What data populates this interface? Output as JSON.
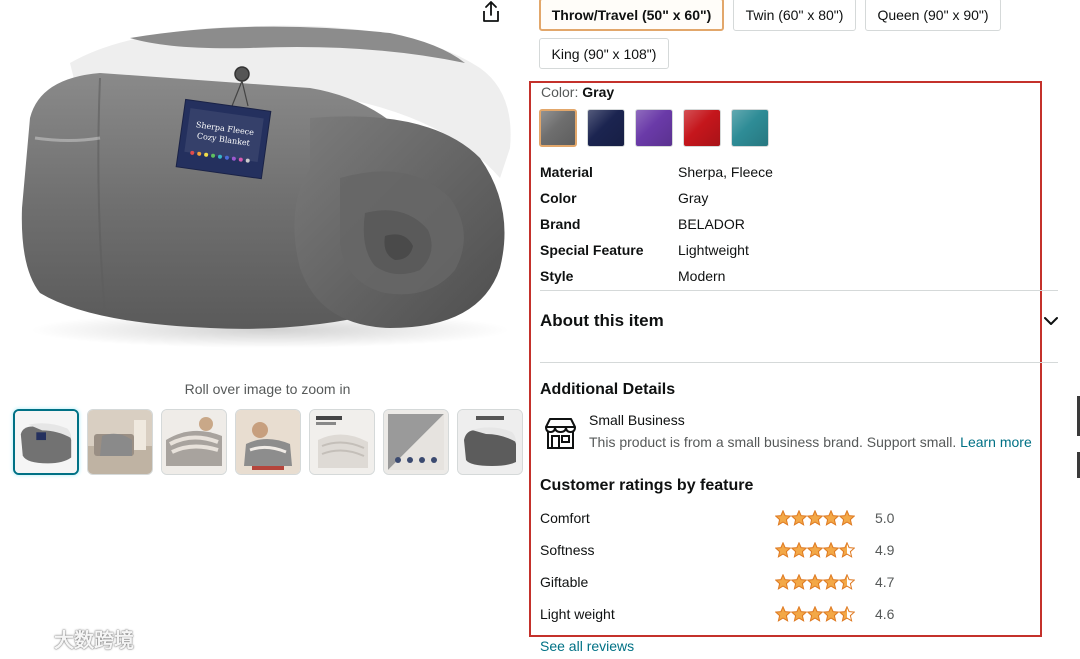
{
  "product": {
    "zoom_hint": "Roll over image to zoom in",
    "tag_line1": "Sherpa Fleece",
    "tag_line2": "Cozy Blanket",
    "tag_brand": "BELADOR"
  },
  "sizes": [
    {
      "label": "Throw/Travel (50\" x 60\")",
      "selected": true
    },
    {
      "label": "Twin (60\" x 80\")",
      "selected": false
    },
    {
      "label": "Queen (90\" x 90\")",
      "selected": false
    },
    {
      "label": "King (90\" x 108\")",
      "selected": false
    }
  ],
  "color": {
    "label": "Color:",
    "selected": "Gray",
    "swatches": [
      "#6e6e6e",
      "#1b2450",
      "#6a3aa8",
      "#c5161c",
      "#2e8c96"
    ]
  },
  "specs": [
    {
      "key": "Material",
      "value": "Sherpa, Fleece"
    },
    {
      "key": "Color",
      "value": "Gray"
    },
    {
      "key": "Brand",
      "value": "BELADOR"
    },
    {
      "key": "Special Feature",
      "value": "Lightweight"
    },
    {
      "key": "Style",
      "value": "Modern"
    }
  ],
  "about": {
    "title": "About this item"
  },
  "additional": {
    "title": "Additional Details",
    "sb_title": "Small Business",
    "sb_desc": "This product is from a small business brand. Support small.",
    "learn_more": "Learn more"
  },
  "ratings": {
    "title": "Customer ratings by feature",
    "items": [
      {
        "name": "Comfort",
        "value": "5.0",
        "stars": 5
      },
      {
        "name": "Softness",
        "value": "4.9",
        "stars": 4.5
      },
      {
        "name": "Giftable",
        "value": "4.7",
        "stars": 4.5
      },
      {
        "name": "Light weight",
        "value": "4.6",
        "stars": 4.5
      }
    ],
    "see_all": "See all reviews"
  },
  "watermark": "大数跨境",
  "colors": {
    "accent_link": "#007185",
    "highlight": "#c4312b",
    "star": "#f3a847",
    "selected_border": "#e2a76b"
  }
}
